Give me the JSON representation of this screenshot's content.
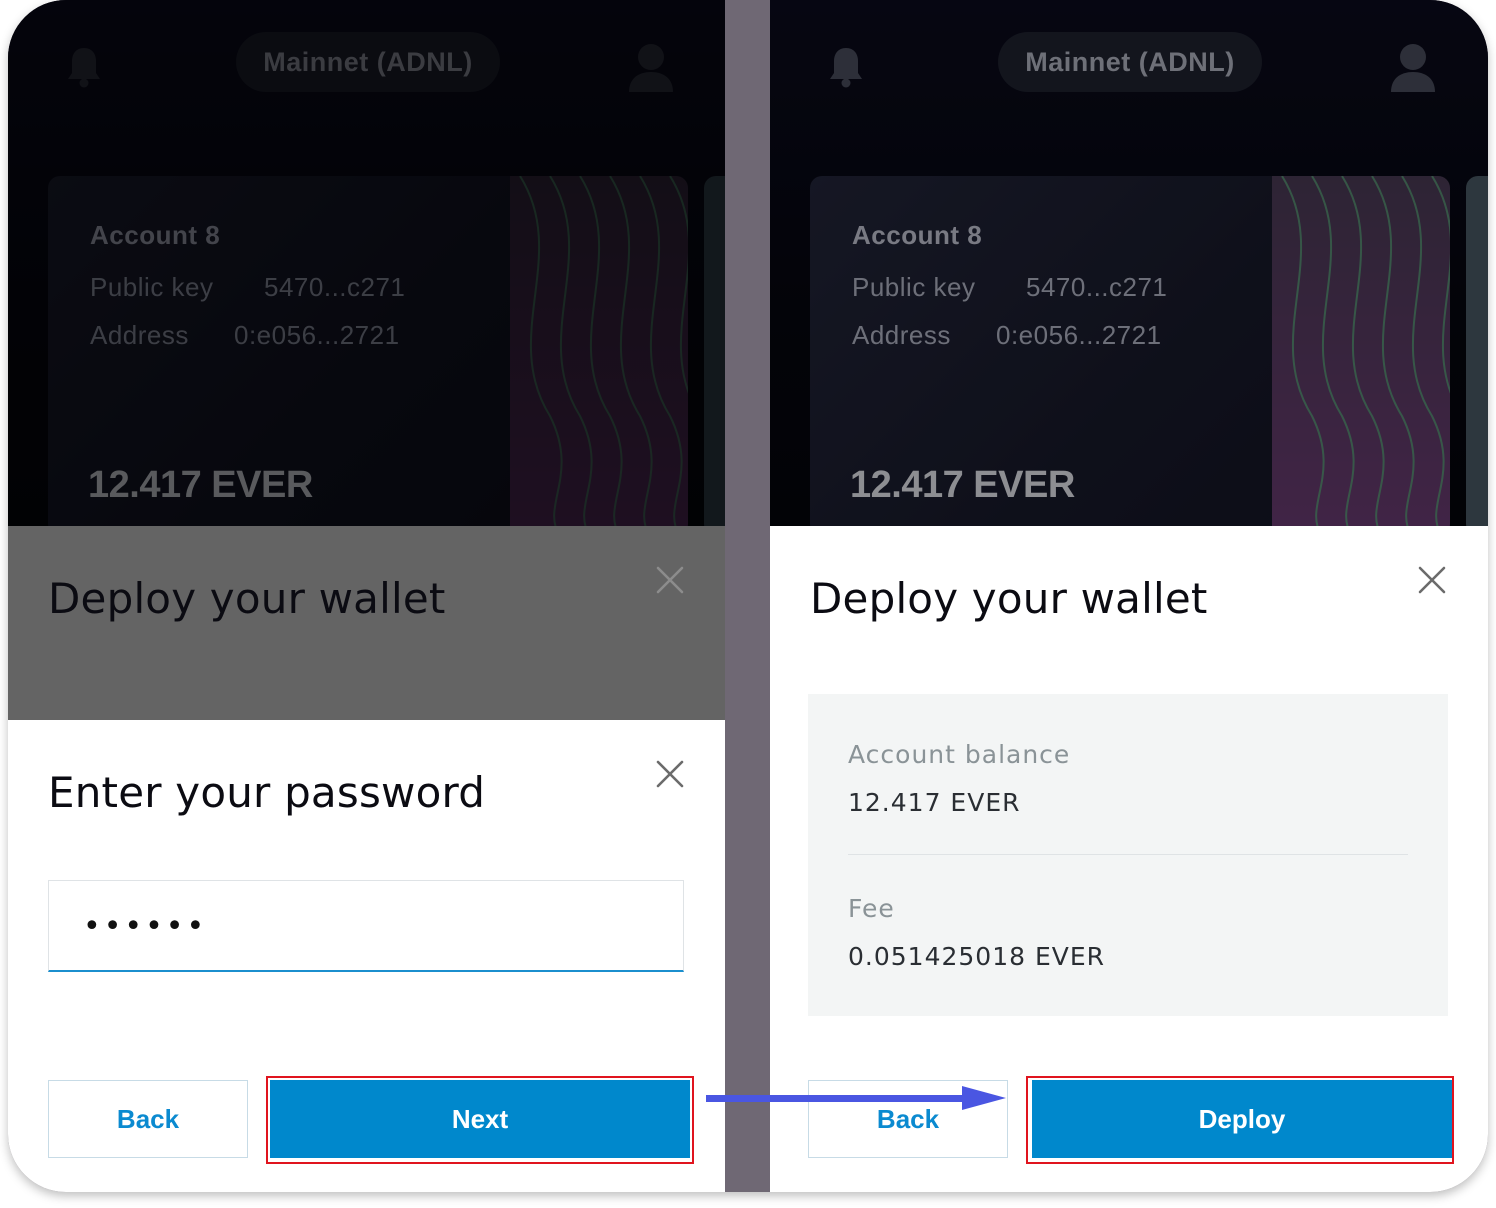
{
  "app": {
    "network": "Mainnet (ADNL)",
    "account": {
      "name": "Account 8",
      "public_key_label": "Public key",
      "public_key_value": "5470...c271",
      "address_label": "Address",
      "address_value": "0:e056...2721",
      "balance": "12.417 EVER"
    }
  },
  "left_panel": {
    "deploy_title": "Deploy your wallet",
    "password_dialog": {
      "title": "Enter your password",
      "password_value": "••••••",
      "back_label": "Back",
      "next_label": "Next"
    }
  },
  "right_panel": {
    "deploy_title": "Deploy your wallet",
    "account_balance_label": "Account balance",
    "account_balance_value": "12.417 EVER",
    "fee_label": "Fee",
    "fee_value": "0.051425018 EVER",
    "back_label": "Back",
    "deploy_label": "Deploy"
  },
  "colors": {
    "primary_button": "#0088cc",
    "highlight_outline": "#e0141e",
    "flow_arrow": "#4a56e2",
    "divider": "#6f6874"
  },
  "icons": [
    "bell-icon",
    "user-icon",
    "close-icon",
    "arrow-right-icon"
  ]
}
